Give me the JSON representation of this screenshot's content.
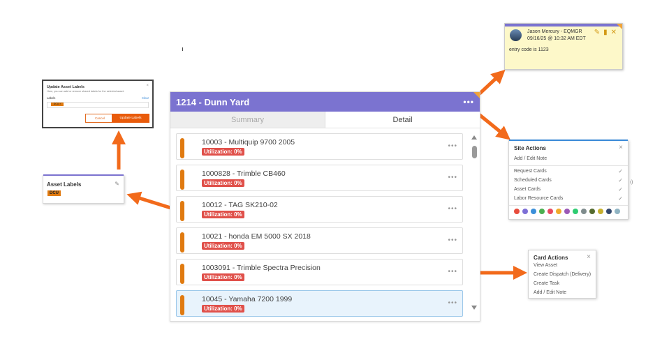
{
  "main": {
    "title": "1214 - Dunn Yard",
    "menu_glyph": "•••",
    "tabs": [
      {
        "label": "Summary",
        "active": false
      },
      {
        "label": "Detail",
        "active": true
      }
    ],
    "cards": [
      {
        "name": "10003 - Multiquip 9700 2005",
        "util": "Utilization: 0%"
      },
      {
        "name": "1000828 - Trimble CB460",
        "util": "Utilization: 0%"
      },
      {
        "name": "10012 - TAG SK210-02",
        "util": "Utilization: 0%"
      },
      {
        "name": "10021 - honda EM 5000 SX 2018",
        "util": "Utilization: 0%"
      },
      {
        "name": "1003091 - Trimble Spectra Precision",
        "util": "Utilization: 0%"
      },
      {
        "name": "10045 - Yamaha 7200 1999",
        "util": "Utilization: 0%"
      }
    ],
    "card_dots": "•••"
  },
  "note": {
    "author": "Jason Mercury - EQMGR",
    "date": "09/16/25 @ 10:32 AM EDT",
    "body": "entry code is 1123",
    "icons": [
      "pencil-icon",
      "trash-icon",
      "close-icon"
    ]
  },
  "site_actions": {
    "title": "Site Actions",
    "close": "×",
    "first": "Add / Edit Note",
    "items": [
      "Request Cards",
      "Scheduled Cards",
      "Asset Cards",
      "Labor Resource Cards"
    ],
    "check": "✓",
    "colors": [
      "#e74c3c",
      "#7d6fd6",
      "#3b8fd9",
      "#4caf50",
      "#e84a5f",
      "#f0ab2a",
      "#9b59b6",
      "#2ecc71",
      "#7f8c8d",
      "#556b2f",
      "#c7b02e",
      "#34496e",
      "#8fb3c2"
    ],
    "stray": "ı)"
  },
  "card_actions": {
    "title": "Card Actions",
    "close": "×",
    "items": [
      "View Asset",
      "Create Dispatch (Delivery)",
      "Create Task",
      "Add / Edit Note"
    ]
  },
  "asset_labels": {
    "title": "Asset Labels",
    "badge": "DCU"
  },
  "update_dialog": {
    "title": "Update Asset Labels",
    "subtitle": "Here, you can add or remove shared labels for the selected asset.",
    "labels_label": "Labels",
    "clear": "Clear",
    "chip": "DCU ×",
    "cancel": "Cancel",
    "update": "Update Labels"
  },
  "colors": {
    "header": "#7b73d0",
    "accent_orange": "#e07a10",
    "arrow": "#f26a1b",
    "utilization_badge": "#e0504a"
  }
}
